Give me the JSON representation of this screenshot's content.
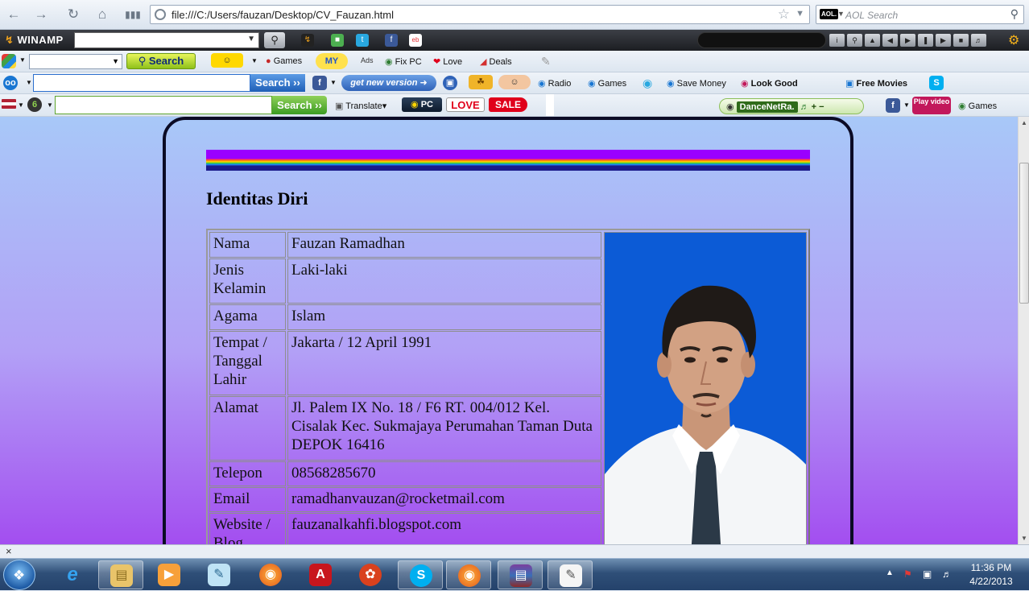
{
  "browser": {
    "url": "file:///C:/Users/fauzan/Desktop/CV_Fauzan.html",
    "search_placeholder": "AOL Search",
    "search_brand": "AOL."
  },
  "winamp": {
    "logo": "WINAMP"
  },
  "toolbar1": {
    "search_label": "Search",
    "games_label": "Games",
    "my_label": "MY",
    "ads_label": "Ads",
    "fixpc_label": "Fix PC",
    "love_label": "Love",
    "deals_label": "Deals"
  },
  "toolbar2": {
    "search_label": "Search ››",
    "get_new_version_label": "get new version",
    "radio_label": "Radio",
    "games_label": "Games",
    "save_money_label": "Save Money",
    "look_good_label": "Look Good",
    "free_movies_label": "Free Movies"
  },
  "toolbar3": {
    "search_label": "Search ››",
    "translate_label": "Translate",
    "pc_label": "PC",
    "love_label": "LOVE",
    "sale_label": "SALE",
    "dance_label": "DanceNetRa.",
    "play_video_label": "Play video",
    "games_label": "Games"
  },
  "page": {
    "heading": "Identitas Diri",
    "rows": [
      {
        "key": "Nama",
        "value": "Fauzan Ramadhan"
      },
      {
        "key": "Jenis Kelamin",
        "value": "Laki-laki"
      },
      {
        "key": "Agama",
        "value": "Islam"
      },
      {
        "key": "Tempat / Tanggal Lahir",
        "value": "Jakarta / 12 April 1991"
      },
      {
        "key": "Alamat",
        "value": "Jl. Palem IX No. 18 / F6 RT. 004/012 Kel. Cisalak Kec. Sukmajaya Perumahan Taman Duta DEPOK 16416"
      },
      {
        "key": "Telepon",
        "value": "08568285670"
      },
      {
        "key": "Email",
        "value": "ramadhanvauzan@rocketmail.com"
      },
      {
        "key": "Website / Blog",
        "value": "fauzanalkahfi.blogspot.com"
      }
    ]
  },
  "tray": {
    "time": "11:36 PM",
    "date": "4/22/2013"
  }
}
